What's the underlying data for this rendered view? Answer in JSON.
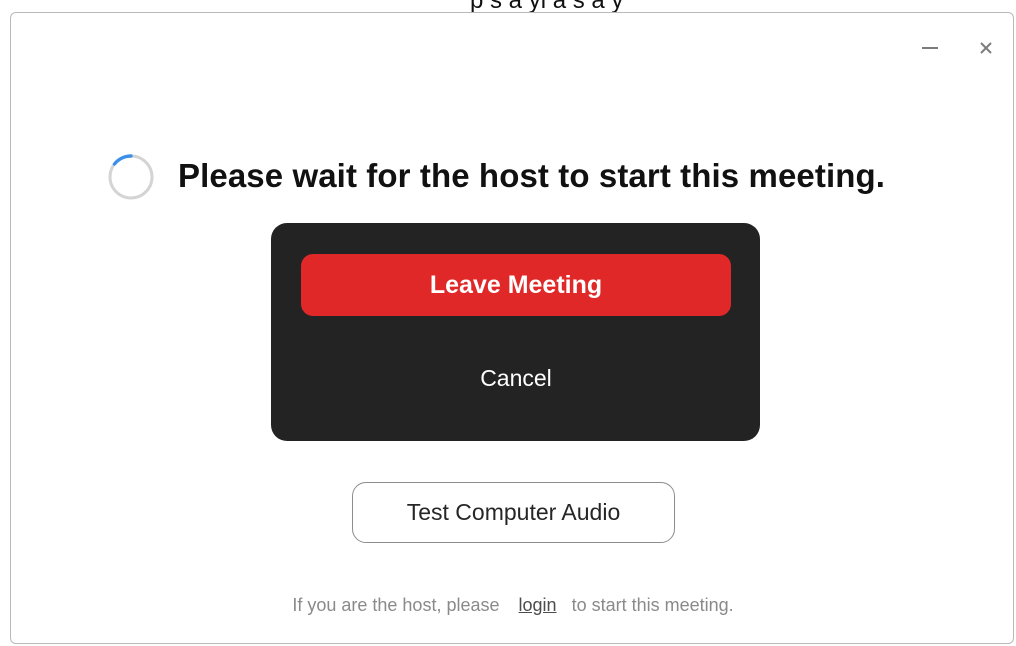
{
  "window": {
    "heading": "Please wait for the host to start this meeting.",
    "leave_label": "Leave Meeting",
    "cancel_label": "Cancel",
    "test_audio_label": "Test Computer Audio",
    "footer": {
      "before": "If you are the host, please",
      "link": "login",
      "after": "to start this meeting."
    }
  },
  "icons": {
    "spinner": "spinner-icon",
    "minimize": "minimize-icon",
    "close": "close-icon"
  },
  "colors": {
    "leave_button": "#e02828",
    "panel_background": "#232323",
    "spinner_accent": "#3b8fe8"
  }
}
